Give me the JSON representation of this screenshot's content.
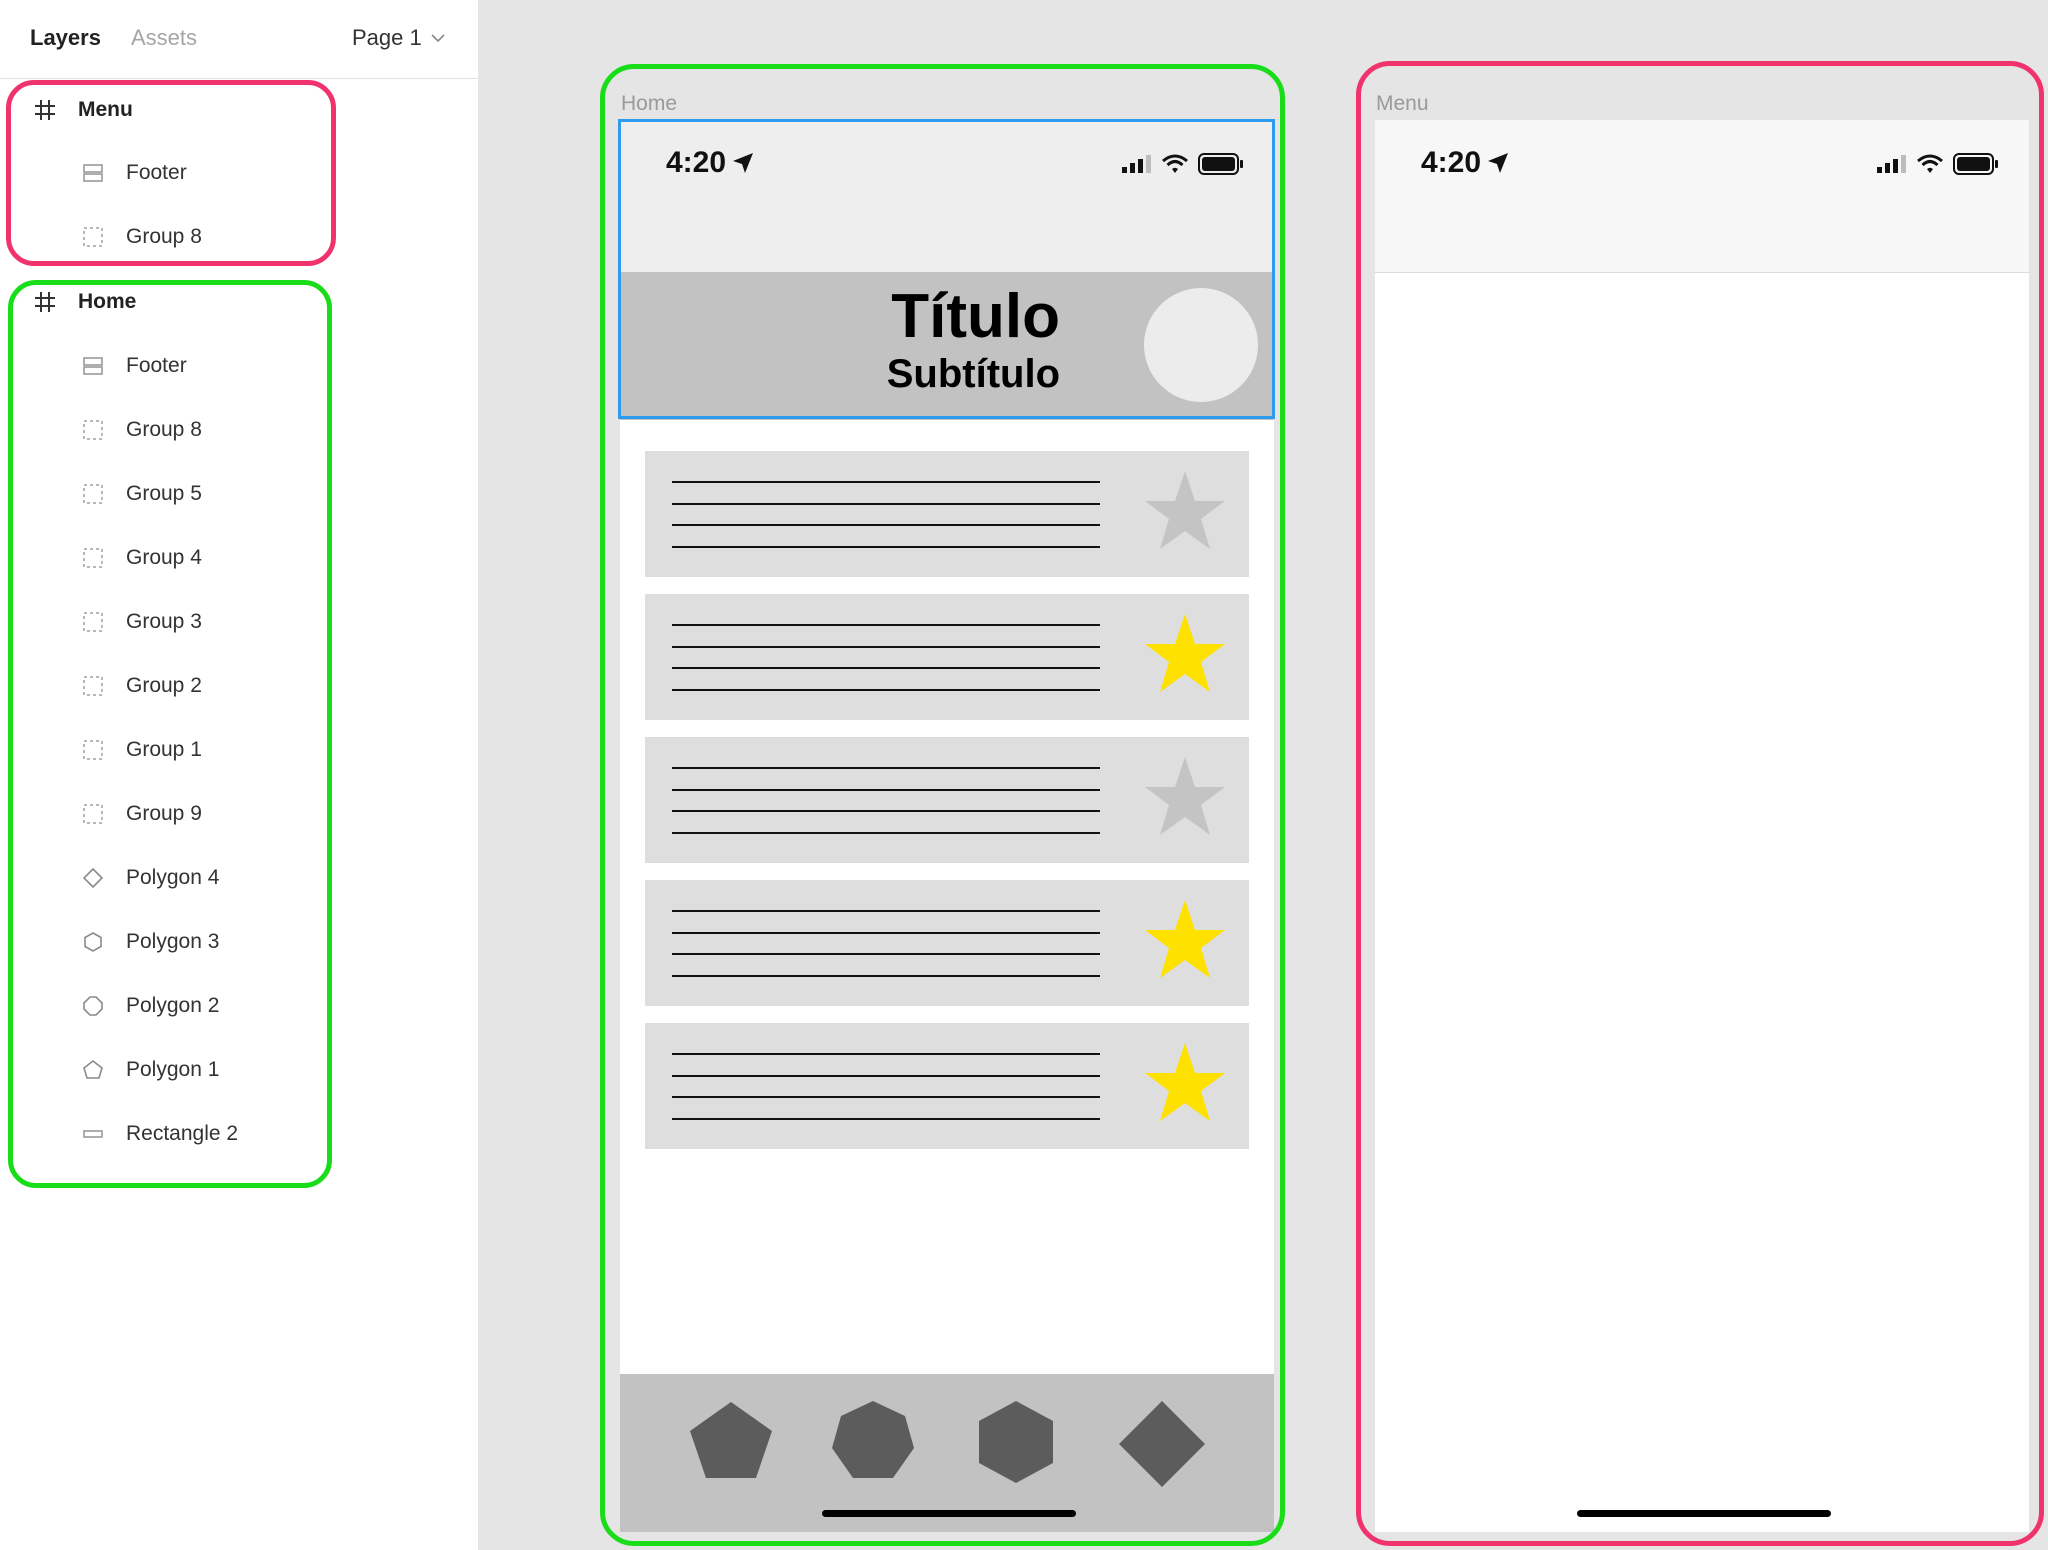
{
  "panel": {
    "tabs": {
      "layers": "Layers",
      "assets": "Assets"
    },
    "page_selector": {
      "label": "Page 1",
      "icon": "chevron-down-icon"
    },
    "layers": [
      {
        "label": "Menu",
        "type": "frame",
        "icon": "frame-hash-icon"
      },
      {
        "label": "Footer",
        "type": "child",
        "icon": "auto-layout-icon"
      },
      {
        "label": "Group 8",
        "type": "child",
        "icon": "group-icon"
      },
      {
        "label": "Home",
        "type": "frame",
        "icon": "frame-hash-icon"
      },
      {
        "label": "Footer",
        "type": "child",
        "icon": "auto-layout-icon"
      },
      {
        "label": "Group 8",
        "type": "child",
        "icon": "group-icon"
      },
      {
        "label": "Group 5",
        "type": "child",
        "icon": "group-icon"
      },
      {
        "label": "Group 4",
        "type": "child",
        "icon": "group-icon"
      },
      {
        "label": "Group 3",
        "type": "child",
        "icon": "group-icon"
      },
      {
        "label": "Group 2",
        "type": "child",
        "icon": "group-icon"
      },
      {
        "label": "Group 1",
        "type": "child",
        "icon": "group-icon"
      },
      {
        "label": "Group 9",
        "type": "child",
        "icon": "group-icon"
      },
      {
        "label": "Polygon 4",
        "type": "child",
        "icon": "diamond-icon"
      },
      {
        "label": "Polygon 3",
        "type": "child",
        "icon": "hexagon-icon"
      },
      {
        "label": "Polygon 2",
        "type": "child",
        "icon": "octagon-icon"
      },
      {
        "label": "Polygon 1",
        "type": "child",
        "icon": "pentagon-icon"
      },
      {
        "label": "Rectangle 2",
        "type": "child",
        "icon": "rectangle-icon"
      }
    ]
  },
  "canvas": {
    "home_frame": {
      "label": "Home",
      "status_time": "4:20",
      "title": "Título",
      "subtitle": "Subtítulo",
      "cards": [
        {
          "starred": false
        },
        {
          "starred": true
        },
        {
          "starred": false
        },
        {
          "starred": true
        },
        {
          "starred": true
        }
      ],
      "footer_icons": [
        "pentagon-icon",
        "heptagon-icon",
        "hexagon-icon",
        "diamond-icon"
      ]
    },
    "menu_frame": {
      "label": "Menu",
      "status_time": "4:20"
    }
  },
  "colors": {
    "frame_highlight_menu": "#f0336d",
    "frame_highlight_home": "#19dd19",
    "selection": "#2f9bef",
    "star_active": "#ffe100",
    "star_inactive": "#c4c4c4",
    "footer_shape": "#5c5c5c"
  }
}
